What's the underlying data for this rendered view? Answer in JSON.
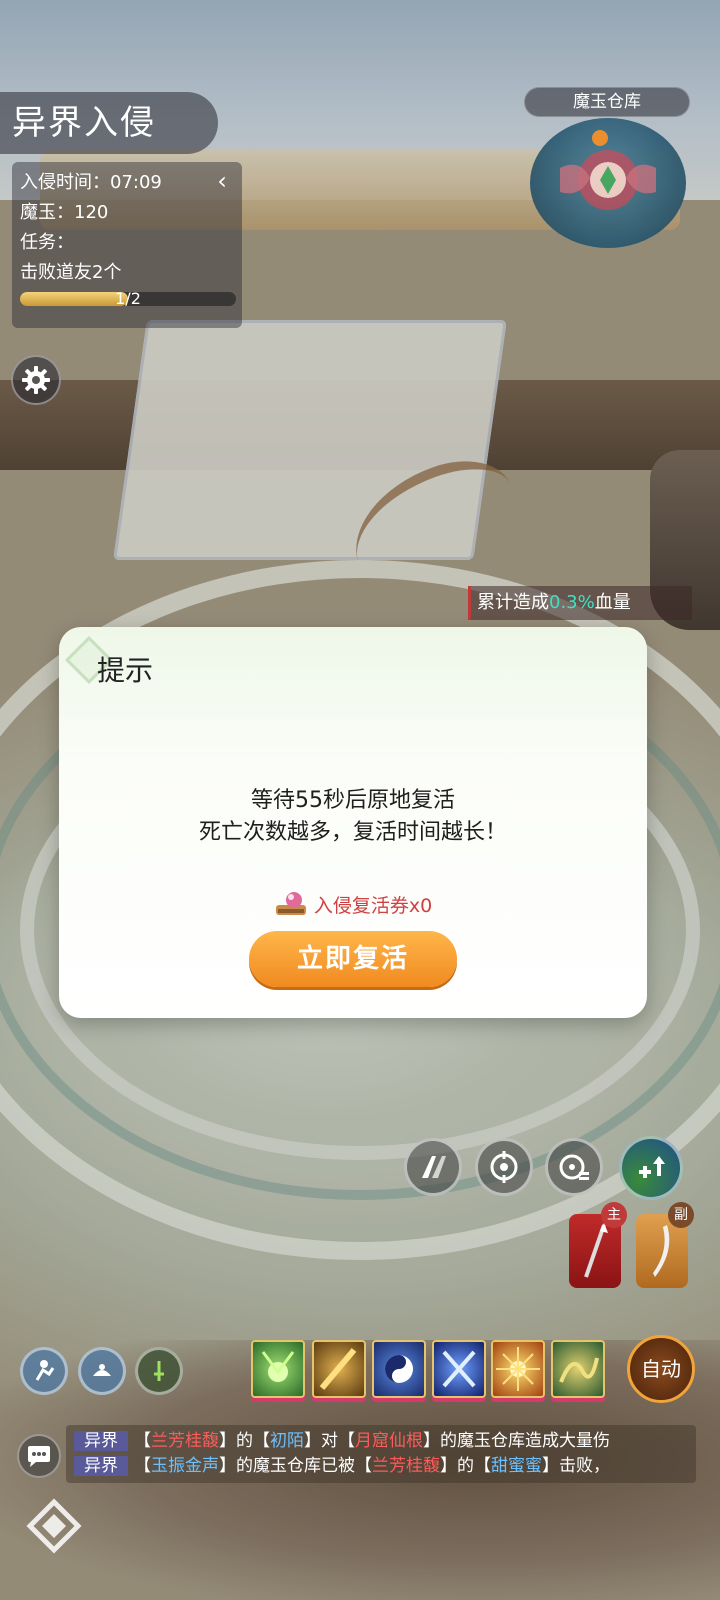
{
  "header": {
    "event_title": "异界入侵",
    "invasion_time_label": "入侵时间：07:09",
    "magic_jade_label": "魔玉：120",
    "task_label": "任务：",
    "task_desc": "击败道友2个",
    "task_progress_text": "1/2",
    "task_progress_fraction": 0.5,
    "collapse_glyph": "‹"
  },
  "minimap": {
    "title": "魔玉仓库"
  },
  "damage_text": {
    "prefix": "累计造成",
    "percent": "0.3%",
    "suffix": "血量"
  },
  "dialog": {
    "title": "提示",
    "line1": "等待55秒后原地复活",
    "line2": "死亡次数越多，复活时间越长！",
    "ticket_label": "入侵复活券x0",
    "revive_button": "立即复活"
  },
  "weapons": {
    "main_tag": "主",
    "sub_tag": "副"
  },
  "auto_button": "自动",
  "chat": {
    "channel": "异界",
    "line1": {
      "p1": "【",
      "n1": "兰芳桂馥",
      "p2": "】的【",
      "n2": "初陌",
      "p3": "】对【",
      "n3": "月窟仙根",
      "p4": "】的魔玉仓库造成大量伤"
    },
    "line2": {
      "p1": "【",
      "n1": "玉振金声",
      "p2": "】的魔玉仓库已被【",
      "n2": "兰芳桂馥",
      "p3": "】的【",
      "n3": "甜蜜蜜",
      "p4": "】击败，"
    }
  },
  "colors": {
    "accent_orange": "#f08a20",
    "damage_teal": "#3fe0c6",
    "ticket_red": "#d04040"
  }
}
